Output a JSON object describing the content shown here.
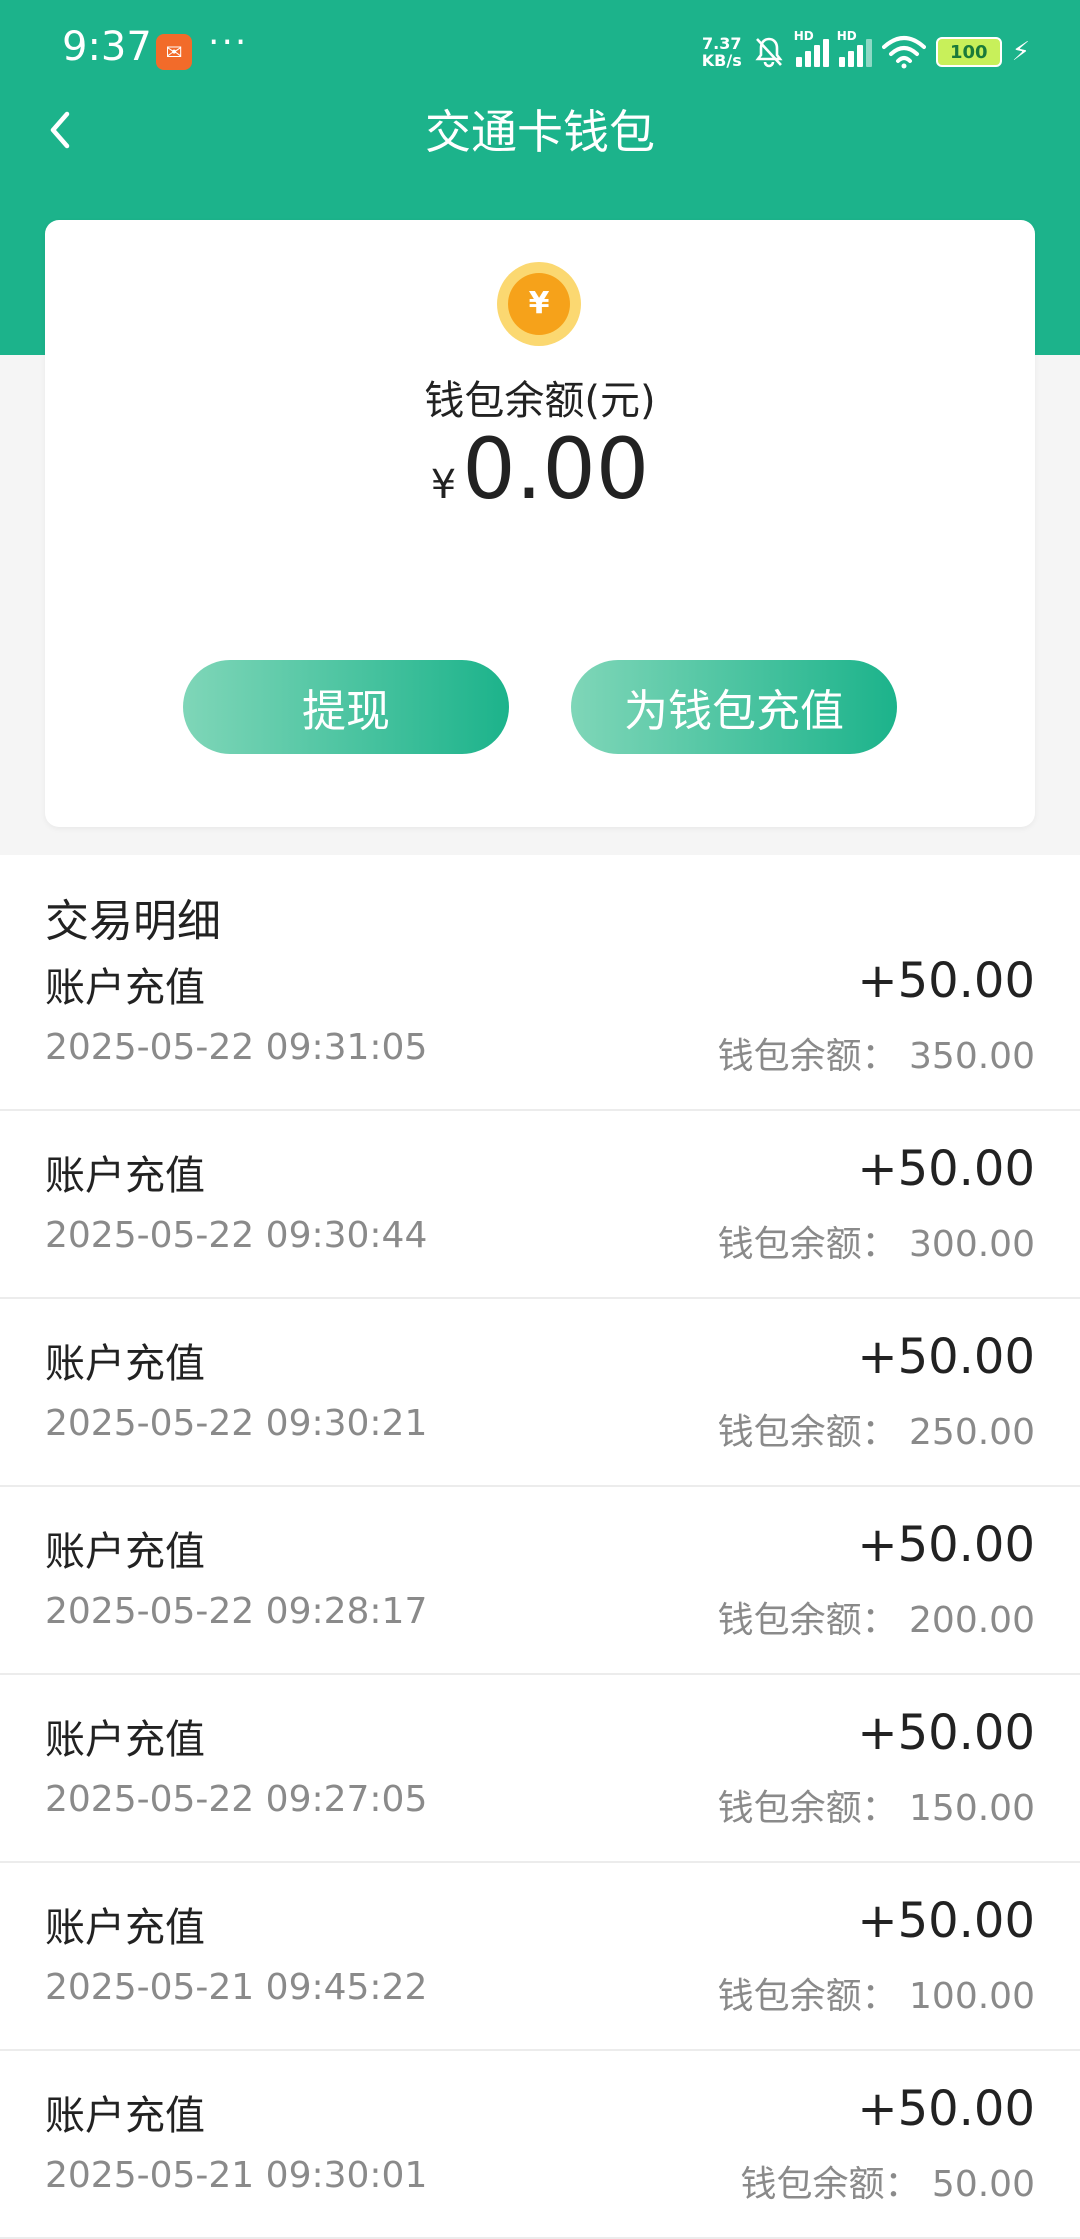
{
  "status_bar": {
    "time": "9:37",
    "more": "···",
    "net_speed_value": "7.37",
    "net_speed_unit": "KB/s",
    "signal_label": "HD",
    "battery": "100"
  },
  "header": {
    "title": "交通卡钱包",
    "color": "#1cb38b"
  },
  "balance_card": {
    "label": "钱包余额(元)",
    "currency_symbol": "¥",
    "amount": "0.00",
    "withdraw_label": "提现",
    "recharge_label": "为钱包充值"
  },
  "transactions": {
    "heading": "交易明细",
    "items": [
      {
        "type": "账户充值",
        "time": "2025-05-22 09:31:05",
        "amount": "+50.00",
        "balance": "钱包余额：  350.00"
      },
      {
        "type": "账户充值",
        "time": "2025-05-22 09:30:44",
        "amount": "+50.00",
        "balance": "钱包余额：  300.00"
      },
      {
        "type": "账户充值",
        "time": "2025-05-22 09:30:21",
        "amount": "+50.00",
        "balance": "钱包余额：  250.00"
      },
      {
        "type": "账户充值",
        "time": "2025-05-22 09:28:17",
        "amount": "+50.00",
        "balance": "钱包余额：  200.00"
      },
      {
        "type": "账户充值",
        "time": "2025-05-22 09:27:05",
        "amount": "+50.00",
        "balance": "钱包余额：  150.00"
      },
      {
        "type": "账户充值",
        "time": "2025-05-21 09:45:22",
        "amount": "+50.00",
        "balance": "钱包余额：  100.00"
      },
      {
        "type": "账户充值",
        "time": "2025-05-21 09:30:01",
        "amount": "+50.00",
        "balance": "钱包余额：  50.00"
      }
    ]
  }
}
